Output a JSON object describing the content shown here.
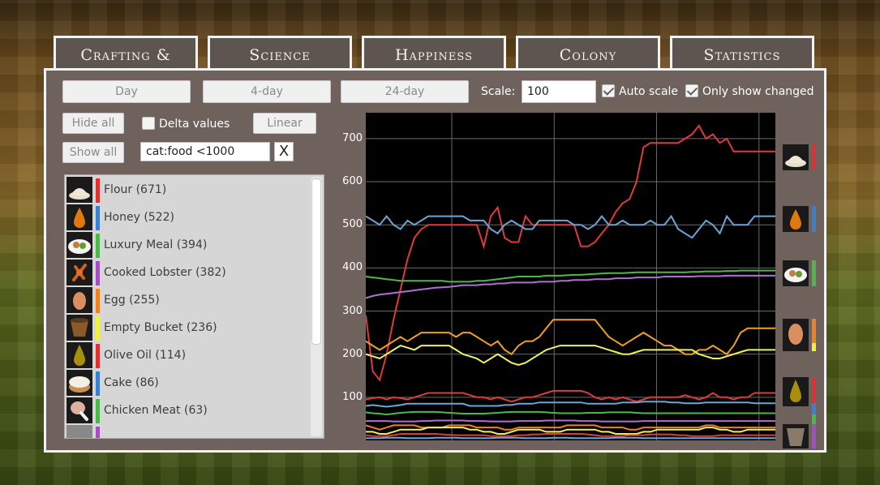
{
  "tabs": [
    {
      "label": "Crafting & Stockpile"
    },
    {
      "label": "Science"
    },
    {
      "label": "Happiness"
    },
    {
      "label": "Colony"
    },
    {
      "label": "Statistics"
    }
  ],
  "controls": {
    "range_day": "Day",
    "range_4day": "4-day",
    "range_24day": "24-day",
    "scale_label": "Scale:",
    "scale_value": "100",
    "auto_scale_label": "Auto scale",
    "auto_scale_checked": true,
    "only_changed_label": "Only show changed",
    "only_changed_checked": true,
    "hide_all": "Hide all",
    "show_all": "Show all",
    "delta_label": "Delta values",
    "delta_checked": false,
    "linear": "Linear",
    "filter_value": "cat:food <1000",
    "clear_filter": "X"
  },
  "items": [
    {
      "name": "Flour (671)",
      "color": "#e03030",
      "icon": "flour-icon"
    },
    {
      "name": "Honey (522)",
      "color": "#3a7fd0",
      "icon": "honey-icon"
    },
    {
      "name": "Luxury Meal (394)",
      "color": "#4cb84c",
      "icon": "luxury-meal-icon"
    },
    {
      "name": "Cooked Lobster (382)",
      "color": "#a050c0",
      "icon": "lobster-icon"
    },
    {
      "name": "Egg (255)",
      "color": "#f08020",
      "icon": "egg-icon"
    },
    {
      "name": "Empty Bucket (236)",
      "color": "#f0f040",
      "icon": "bucket-icon"
    },
    {
      "name": "Olive Oil (114)",
      "color": "#e03030",
      "icon": "olive-oil-icon"
    },
    {
      "name": "Cake (86)",
      "color": "#3a7fd0",
      "icon": "cake-icon"
    },
    {
      "name": "Chicken Meat (63)",
      "color": "#4cb84c",
      "icon": "chicken-meat-icon"
    }
  ],
  "chart_data": {
    "type": "line",
    "ylim": [
      0,
      760
    ],
    "yticks": [
      "100",
      "200",
      "300",
      "400",
      "500",
      "600",
      "700"
    ],
    "x_count": 60,
    "series": [
      {
        "color": "#e03a3a",
        "values": [
          290,
          160,
          140,
          200,
          280,
          350,
          420,
          470,
          490,
          500,
          500,
          500,
          500,
          500,
          500,
          500,
          500,
          450,
          520,
          540,
          470,
          460,
          460,
          520,
          500,
          500,
          500,
          500,
          500,
          500,
          500,
          450,
          450,
          460,
          480,
          500,
          530,
          550,
          560,
          600,
          680,
          690,
          690,
          690,
          690,
          690,
          700,
          710,
          730,
          700,
          710,
          690,
          700,
          670,
          670,
          670,
          670,
          670,
          670,
          670
        ]
      },
      {
        "color": "#6aa6d8",
        "values": [
          520,
          510,
          500,
          520,
          500,
          490,
          510,
          500,
          510,
          520,
          520,
          520,
          520,
          520,
          520,
          510,
          510,
          510,
          490,
          480,
          500,
          510,
          500,
          490,
          490,
          510,
          510,
          510,
          510,
          510,
          500,
          500,
          490,
          500,
          520,
          500,
          500,
          510,
          500,
          500,
          500,
          510,
          500,
          500,
          520,
          490,
          480,
          470,
          490,
          510,
          500,
          480,
          520,
          500,
          500,
          500,
          520,
          520,
          520,
          520
        ]
      },
      {
        "color": "#4cb84c",
        "values": [
          380,
          378,
          376,
          374,
          372,
          370,
          370,
          370,
          370,
          370,
          370,
          370,
          368,
          368,
          368,
          368,
          370,
          370,
          372,
          374,
          376,
          378,
          380,
          380,
          380,
          380,
          382,
          382,
          382,
          383,
          384,
          384,
          385,
          386,
          387,
          388,
          388,
          388,
          389,
          390,
          390,
          390,
          390,
          390,
          390,
          390,
          390,
          391,
          391,
          392,
          392,
          392,
          393,
          393,
          394,
          394,
          394,
          394,
          394,
          394
        ]
      },
      {
        "color": "#b070d0",
        "values": [
          330,
          335,
          338,
          340,
          342,
          344,
          346,
          348,
          350,
          352,
          354,
          355,
          356,
          358,
          360,
          360,
          360,
          362,
          362,
          364,
          364,
          366,
          366,
          366,
          366,
          368,
          368,
          368,
          370,
          370,
          372,
          372,
          372,
          374,
          374,
          374,
          376,
          376,
          376,
          378,
          378,
          378,
          378,
          380,
          380,
          380,
          380,
          380,
          381,
          381,
          381,
          381,
          382,
          382,
          382,
          382,
          382,
          382,
          382,
          382
        ]
      },
      {
        "color": "#f0a020",
        "values": [
          230,
          220,
          210,
          220,
          230,
          240,
          230,
          240,
          250,
          250,
          250,
          250,
          250,
          240,
          250,
          250,
          240,
          230,
          220,
          230,
          210,
          200,
          220,
          230,
          230,
          240,
          260,
          280,
          280,
          280,
          280,
          280,
          280,
          280,
          260,
          240,
          230,
          220,
          230,
          240,
          250,
          240,
          230,
          220,
          220,
          210,
          200,
          200,
          210,
          210,
          220,
          210,
          200,
          220,
          250,
          260,
          260,
          260,
          260,
          260
        ]
      },
      {
        "color": "#f0f060",
        "values": [
          200,
          195,
          190,
          200,
          210,
          220,
          215,
          210,
          220,
          220,
          220,
          220,
          220,
          210,
          200,
          195,
          190,
          180,
          190,
          200,
          190,
          180,
          175,
          180,
          190,
          200,
          210,
          215,
          220,
          220,
          220,
          220,
          220,
          220,
          215,
          210,
          205,
          200,
          200,
          205,
          210,
          210,
          210,
          210,
          210,
          210,
          210,
          210,
          200,
          195,
          190,
          190,
          195,
          200,
          205,
          210,
          210,
          210,
          210,
          210
        ]
      },
      {
        "color": "#e03a3a",
        "values": [
          95,
          98,
          100,
          95,
          100,
          98,
          95,
          100,
          105,
          110,
          110,
          110,
          110,
          110,
          110,
          105,
          100,
          100,
          95,
          100,
          95,
          90,
          95,
          100,
          100,
          105,
          110,
          115,
          115,
          115,
          115,
          115,
          110,
          100,
          95,
          100,
          95,
          100,
          95,
          90,
          95,
          100,
          100,
          100,
          100,
          100,
          105,
          100,
          95,
          100,
          110,
          100,
          100,
          95,
          100,
          100,
          110,
          110,
          110,
          110
        ]
      },
      {
        "color": "#6aa6d8",
        "values": [
          80,
          82,
          80,
          78,
          80,
          82,
          85,
          85,
          85,
          85,
          85,
          85,
          85,
          85,
          85,
          80,
          80,
          80,
          80,
          80,
          82,
          82,
          85,
          85,
          85,
          88,
          88,
          88,
          88,
          88,
          88,
          88,
          85,
          85,
          85,
          85,
          85,
          88,
          88,
          88,
          90,
          90,
          90,
          90,
          88,
          88,
          86,
          86,
          86,
          88,
          88,
          88,
          88,
          88,
          88,
          88,
          86,
          86,
          86,
          86
        ]
      },
      {
        "color": "#4cb84c",
        "values": [
          65,
          63,
          62,
          60,
          62,
          64,
          65,
          66,
          66,
          66,
          66,
          65,
          64,
          63,
          62,
          62,
          62,
          62,
          63,
          64,
          65,
          66,
          66,
          66,
          66,
          66,
          65,
          64,
          63,
          63,
          63,
          63,
          64,
          64,
          64,
          65,
          65,
          65,
          65,
          64,
          63,
          63,
          63,
          63,
          63,
          63,
          63,
          63,
          63,
          63,
          63,
          63,
          63,
          63,
          63,
          63,
          63,
          63,
          63,
          63
        ]
      },
      {
        "color": "#b070d0",
        "values": [
          45,
          45,
          45,
          45,
          44,
          44,
          44,
          44,
          45,
          45,
          46,
          46,
          46,
          46,
          46,
          45,
          45,
          45,
          44,
          44,
          44,
          44,
          45,
          45,
          45,
          45,
          46,
          46,
          46,
          46,
          46,
          45,
          45,
          45,
          44,
          44,
          44,
          44,
          44,
          44,
          45,
          45,
          45,
          45,
          45,
          45,
          45,
          45,
          45,
          45,
          45,
          45,
          45,
          45,
          45,
          45,
          45,
          45,
          45,
          45
        ]
      },
      {
        "color": "#f08020",
        "values": [
          35,
          30,
          25,
          30,
          35,
          35,
          35,
          35,
          30,
          30,
          30,
          30,
          35,
          35,
          35,
          35,
          30,
          30,
          30,
          30,
          25,
          25,
          30,
          30,
          30,
          30,
          30,
          30,
          30,
          35,
          35,
          35,
          35,
          35,
          30,
          30,
          30,
          30,
          25,
          25,
          30,
          30,
          30,
          30,
          30,
          30,
          30,
          30,
          30,
          35,
          35,
          30,
          30,
          30,
          30,
          30,
          30,
          30,
          30,
          30
        ]
      },
      {
        "color": "#f0f060",
        "values": [
          20,
          20,
          15,
          15,
          20,
          25,
          25,
          25,
          25,
          30,
          30,
          30,
          30,
          30,
          30,
          25,
          25,
          20,
          20,
          15,
          15,
          20,
          25,
          25,
          25,
          25,
          20,
          20,
          20,
          25,
          25,
          25,
          25,
          25,
          20,
          20,
          15,
          15,
          15,
          15,
          20,
          20,
          25,
          25,
          25,
          25,
          25,
          25,
          25,
          30,
          30,
          25,
          25,
          20,
          20,
          25,
          25,
          25,
          25,
          25
        ]
      },
      {
        "color": "#e03a3a",
        "values": [
          12,
          10,
          10,
          10,
          12,
          15,
          15,
          15,
          15,
          15,
          15,
          14,
          13,
          12,
          12,
          12,
          12,
          12,
          10,
          10,
          10,
          10,
          12,
          12,
          14,
          14,
          15,
          15,
          15,
          15,
          15,
          15,
          14,
          12,
          10,
          10,
          10,
          10,
          12,
          12,
          12,
          14,
          14,
          14,
          14,
          12,
          12,
          10,
          10,
          10,
          10,
          12,
          12,
          12,
          12,
          12,
          12,
          12,
          12,
          12
        ]
      },
      {
        "color": "#6aa6d8",
        "values": [
          5,
          5,
          5,
          6,
          6,
          6,
          5,
          5,
          5,
          5,
          6,
          6,
          6,
          6,
          5,
          5,
          5,
          5,
          5,
          6,
          6,
          6,
          6,
          5,
          5,
          5,
          5,
          6,
          6,
          6,
          5,
          5,
          5,
          5,
          5,
          5,
          6,
          6,
          6,
          6,
          5,
          5,
          5,
          5,
          5,
          5,
          5,
          5,
          5,
          5,
          5,
          5,
          5,
          5,
          5,
          5,
          5,
          5,
          5,
          5
        ]
      }
    ]
  },
  "side_legend": [
    {
      "icon": "flour-icon",
      "colors": [
        "#e03030"
      ]
    },
    {
      "icon": "honey-icon",
      "colors": [
        "#3a7fd0"
      ]
    },
    {
      "icon": "luxury-meal-icon",
      "colors": [
        "#4cb84c"
      ]
    },
    {
      "icon": "egg-icon",
      "colors": [
        "#f08020",
        "#f0f040"
      ]
    },
    {
      "icon": "olive-oil-icon",
      "colors": [
        "#e03030",
        "#3a7fd0",
        "#4cb84c"
      ]
    },
    {
      "icon": "bucket-icon",
      "colors": [
        "#a050c0"
      ]
    }
  ]
}
